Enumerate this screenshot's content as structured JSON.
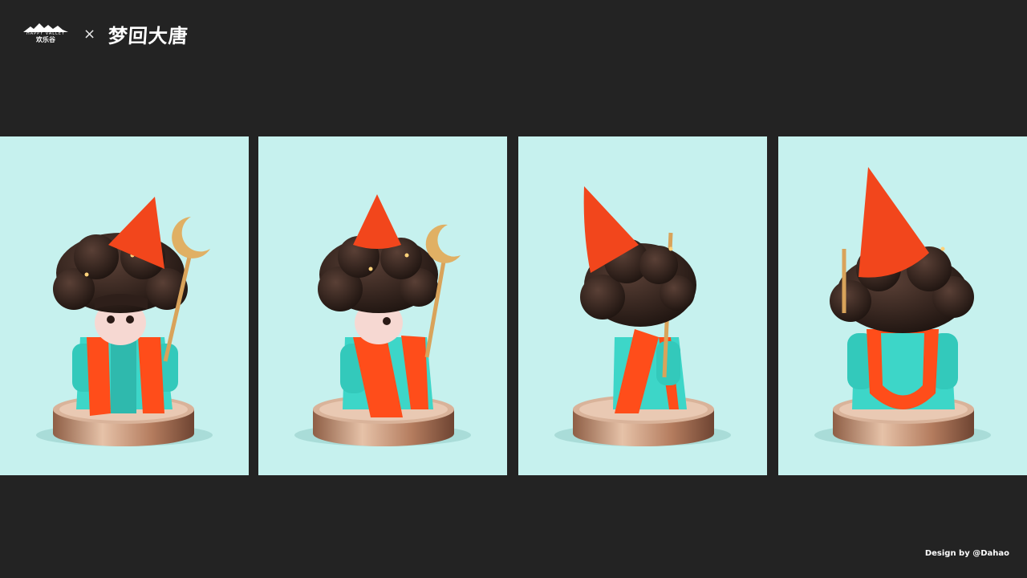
{
  "header": {
    "brand_logo_en": "HAPPY VALLEY",
    "brand_logo_cn": "欢乐谷",
    "separator": "×",
    "title": "梦回大唐"
  },
  "views": [
    {
      "name": "front"
    },
    {
      "name": "three-quarter-right"
    },
    {
      "name": "three-quarter-back-left"
    },
    {
      "name": "back"
    }
  ],
  "colors": {
    "page_background": "#232323",
    "panel_background": "#c6f1ee",
    "robe_teal": "#3dd6c8",
    "sash_orange": "#ff4d1a",
    "hat_orange": "#f2461c",
    "hair_brown": "#2e1f1a",
    "base_bronze": "#c9977a",
    "staff_gold": "#d9a35a"
  },
  "footer": {
    "credit": "Design by @Dahao"
  }
}
